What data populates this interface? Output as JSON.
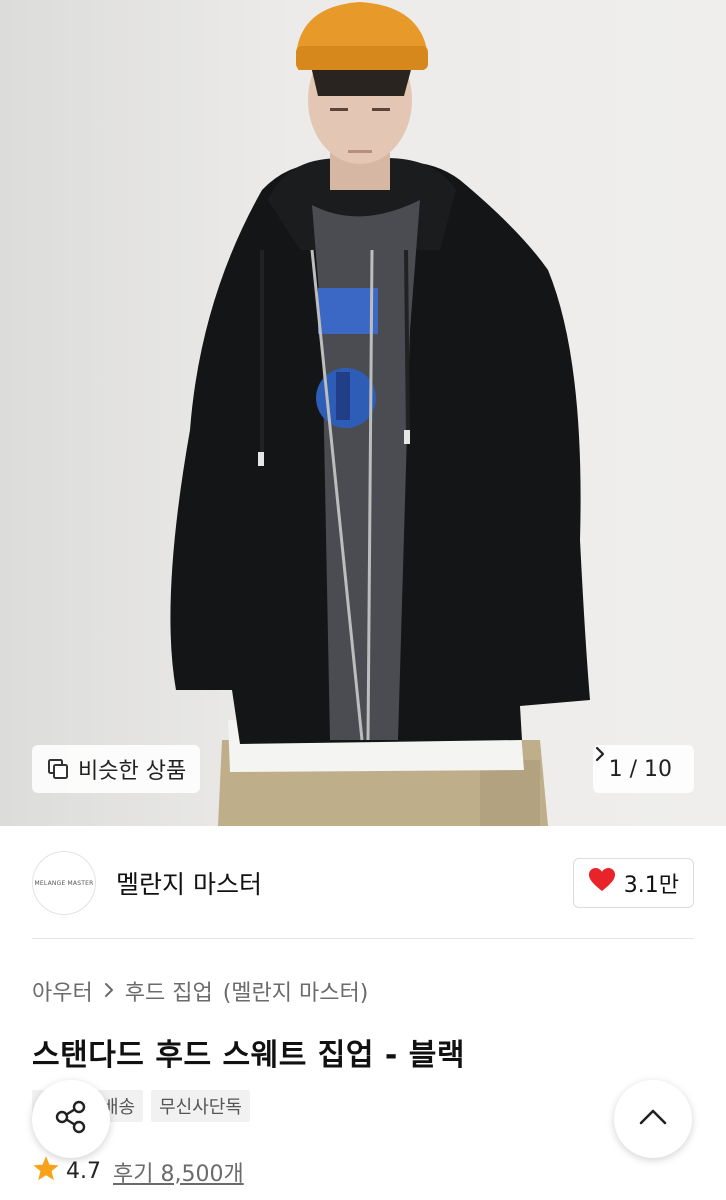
{
  "gallery": {
    "similar_label": "비슷한 상품",
    "pager": "1 / 10",
    "image_description_icon": "model-photo"
  },
  "brand": {
    "logo_text": "MELANGE MASTER",
    "name": "멜란지 마스터",
    "likes": "3.1만"
  },
  "product": {
    "breadcrumb": [
      "아우터",
      "후드 집업",
      "(멜란지 마스터)"
    ],
    "title": "스탠다드 후드 스웨트 집업 - 블랙",
    "badges": [
      "배송",
      "무신사단독"
    ],
    "rating": "4.7",
    "reviews": "후기 8,500개"
  },
  "colors": {
    "heart": "#e8232a",
    "star": "#f7a21a"
  }
}
